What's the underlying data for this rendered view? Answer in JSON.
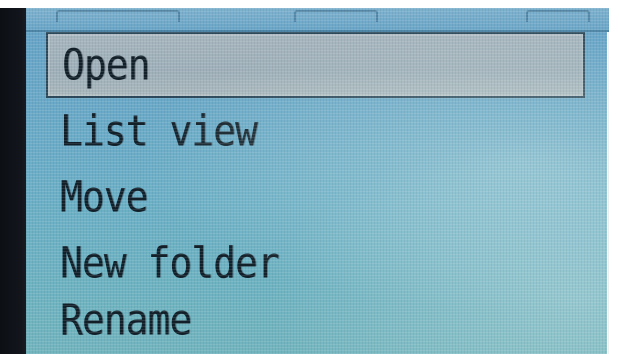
{
  "menu": {
    "items": [
      {
        "label": "Open",
        "selected": true
      },
      {
        "label": "List view",
        "selected": false
      },
      {
        "label": "Move",
        "selected": false
      },
      {
        "label": "New folder",
        "selected": false
      },
      {
        "label": "Rename",
        "selected": false
      }
    ]
  },
  "colors": {
    "screen_background": "#6aabc8",
    "selection_highlight": "#a4b4bd",
    "text": "#12202a",
    "bezel": "#12161c"
  }
}
